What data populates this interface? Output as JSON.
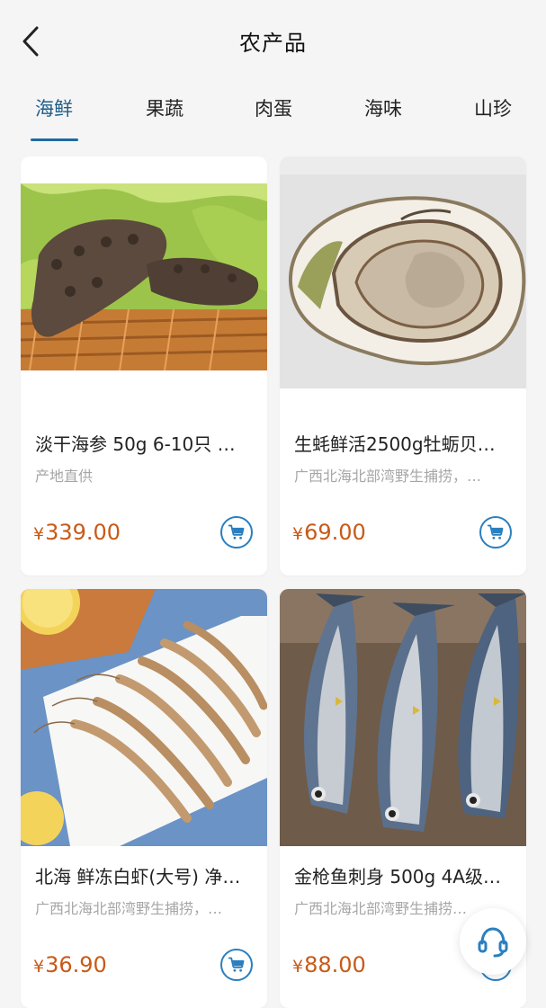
{
  "header": {
    "back_icon": "chevron-left-icon",
    "title": "农产品"
  },
  "tabs": [
    {
      "label": "海鲜",
      "active": true
    },
    {
      "label": "果蔬",
      "active": false
    },
    {
      "label": "肉蛋",
      "active": false
    },
    {
      "label": "海味",
      "active": false
    },
    {
      "label": "山珍",
      "active": false
    }
  ],
  "products": [
    {
      "name": "淡干海参 50g 6-10只 …",
      "desc": "产地直供",
      "currency": "¥",
      "price": "339.00",
      "image": "sea-cucumber-photo"
    },
    {
      "name": "生蚝鲜活2500g牡蛎贝…",
      "desc": "广西北海北部湾野生捕捞，…",
      "currency": "¥",
      "price": "69.00",
      "image": "oyster-photo"
    },
    {
      "name": "北海 鲜冻白虾(大号) 净…",
      "desc": "广西北海北部湾野生捕捞，…",
      "currency": "¥",
      "price": "36.90",
      "image": "shrimp-photo"
    },
    {
      "name": "金枪鱼刺身 500g 4A级…",
      "desc": "广西北海北部湾野生捕捞…",
      "currency": "¥",
      "price": "88.00",
      "image": "tuna-photo"
    }
  ],
  "colors": {
    "accent": "#1f6aa0",
    "price": "#c85a17",
    "cart_border": "#2a7fbf",
    "background": "#f5f5f6"
  },
  "floating": {
    "icon": "headset-support-icon"
  }
}
